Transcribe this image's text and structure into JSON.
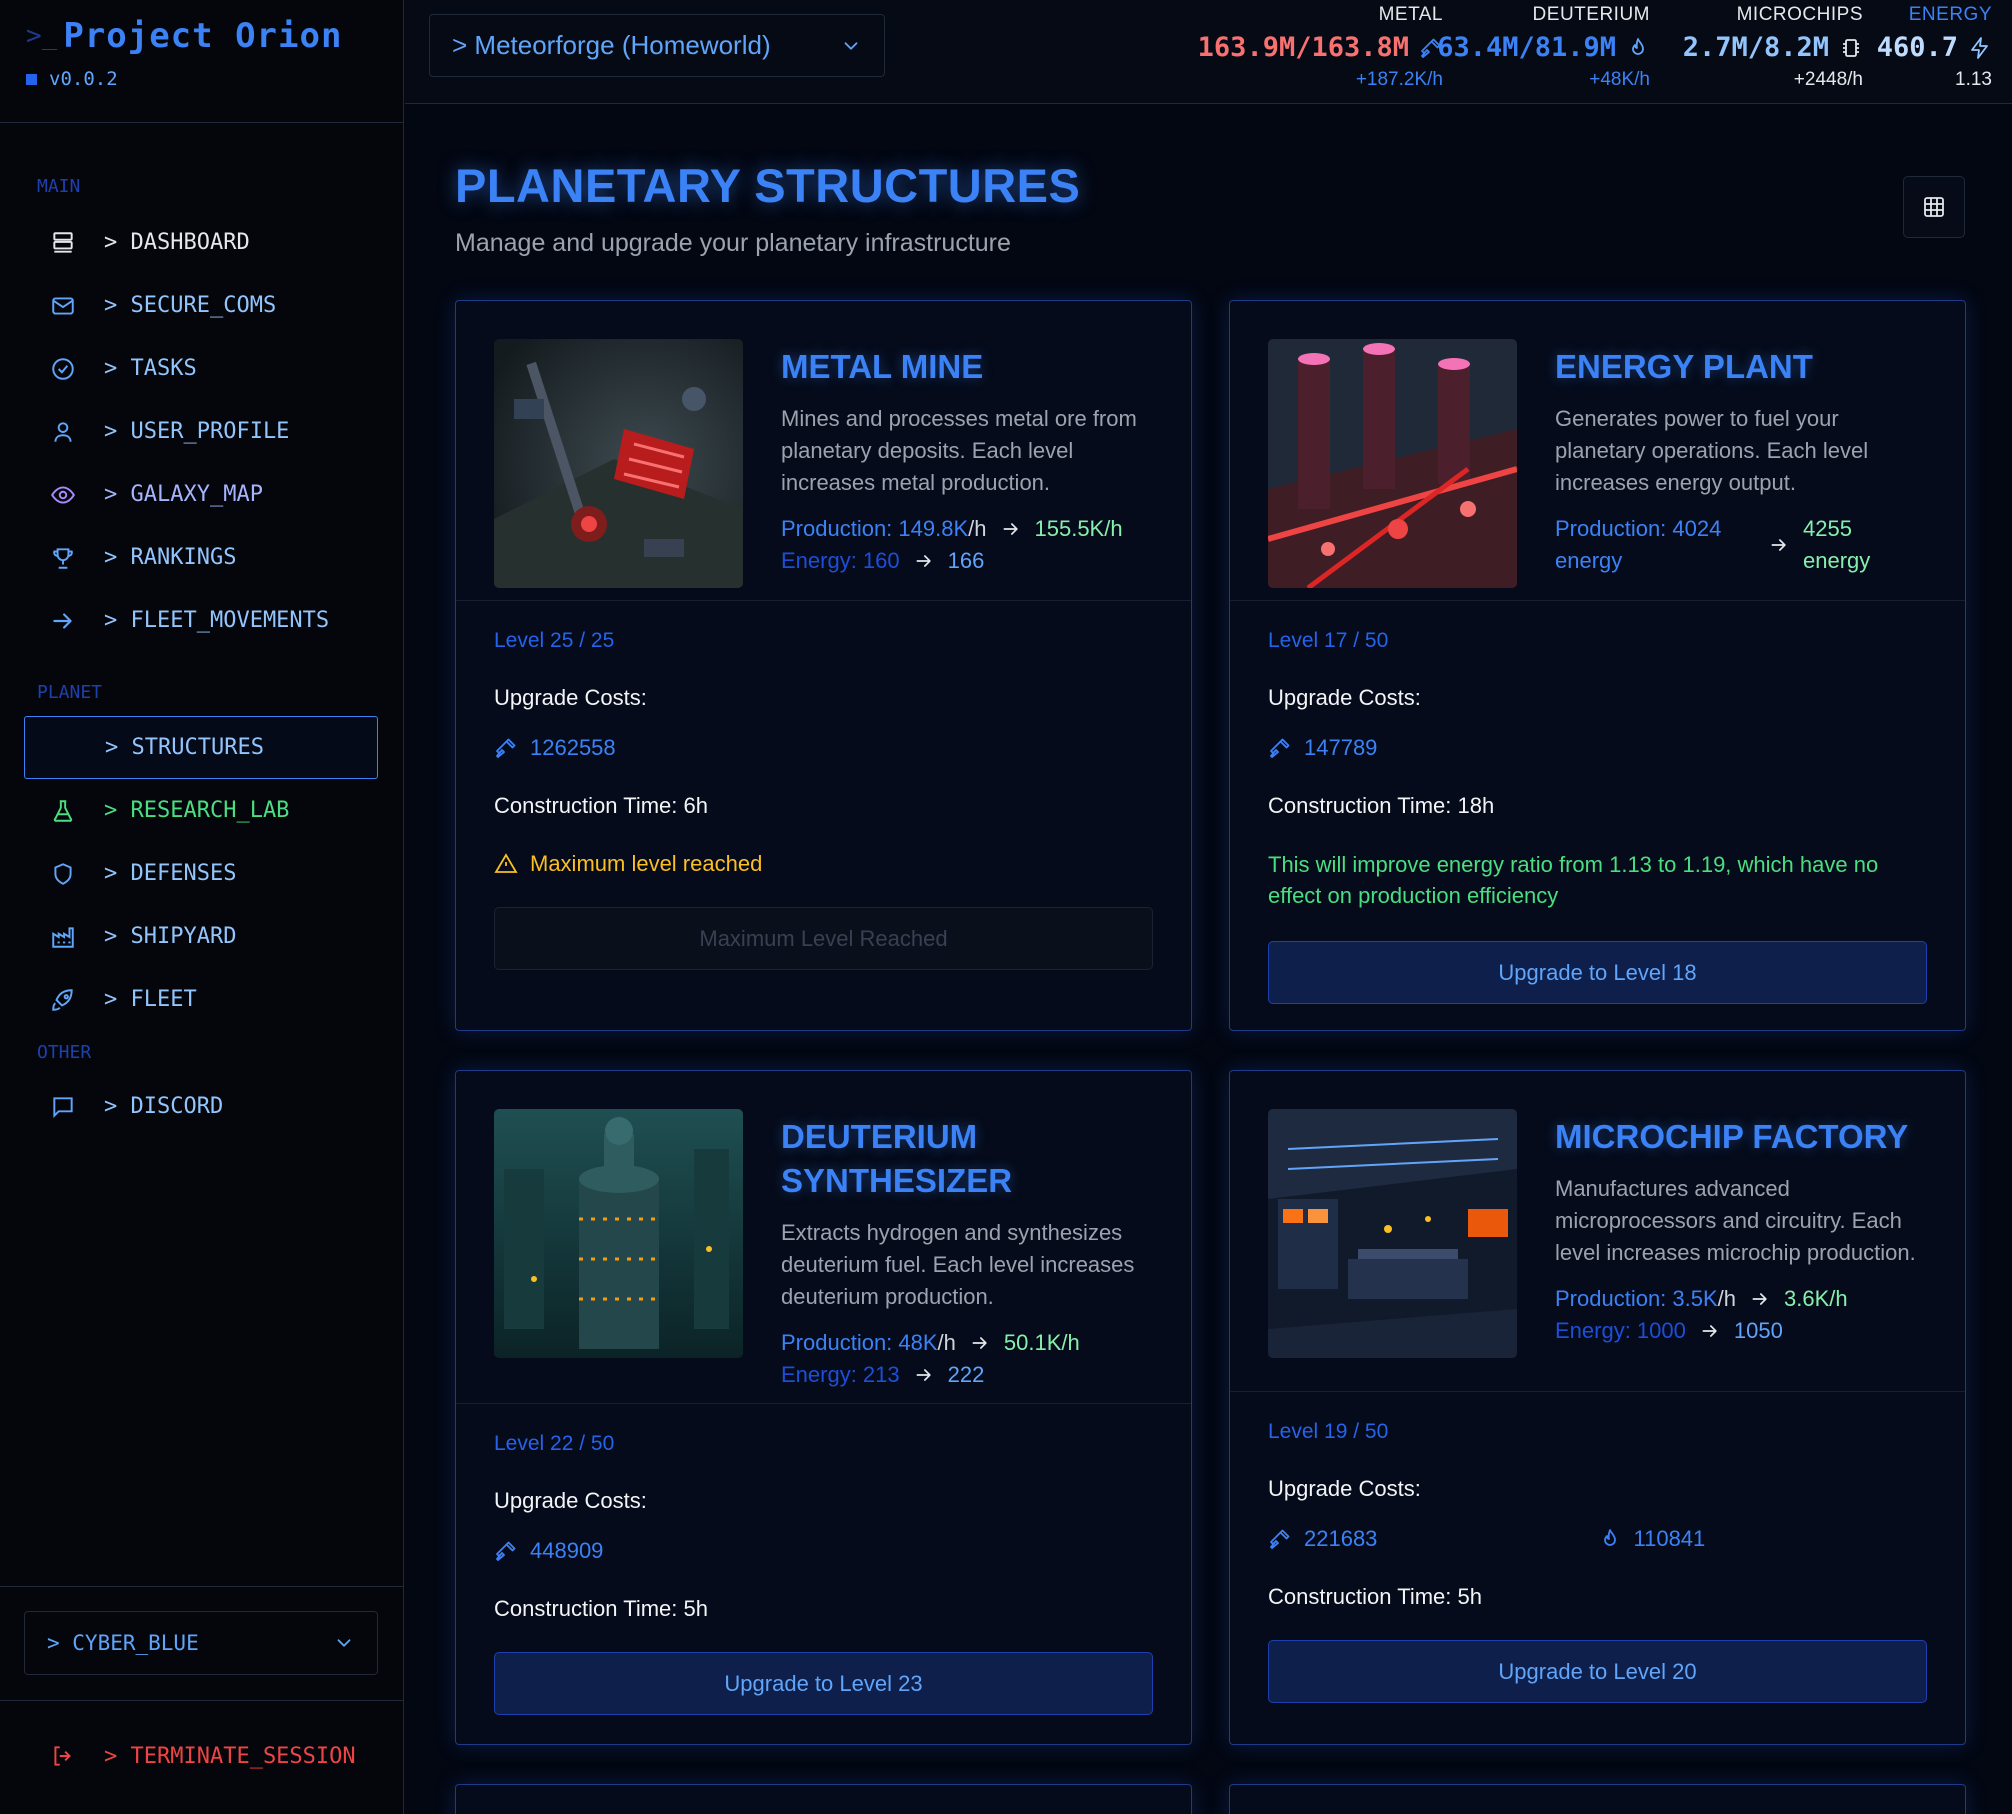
{
  "app": {
    "prompt": ">_",
    "name": "Project Orion",
    "version": "v0.0.2"
  },
  "sidebar": {
    "sections": {
      "main": "MAIN",
      "planet": "PLANET",
      "other": "OTHER"
    },
    "items": [
      {
        "label": "> DASHBOARD",
        "icon": "server-icon"
      },
      {
        "label": "> SECURE_COMS",
        "icon": "mail-icon"
      },
      {
        "label": "> TASKS",
        "icon": "check-circle-icon"
      },
      {
        "label": "> USER_PROFILE",
        "icon": "user-icon"
      },
      {
        "label": "> GALAXY_MAP",
        "icon": "eye-icon"
      },
      {
        "label": "> RANKINGS",
        "icon": "trophy-icon"
      },
      {
        "label": "> FLEET_MOVEMENTS",
        "icon": "arrow-right-icon"
      },
      {
        "label": "> STRUCTURES",
        "icon": "",
        "active": true
      },
      {
        "label": "> RESEARCH_LAB",
        "icon": "flask-icon"
      },
      {
        "label": "> DEFENSES",
        "icon": "shield-icon"
      },
      {
        "label": "> SHIPYARD",
        "icon": "factory-icon"
      },
      {
        "label": "> FLEET",
        "icon": "rocket-icon"
      },
      {
        "label": "> DISCORD",
        "icon": "message-icon"
      }
    ],
    "theme": "> CYBER_BLUE",
    "logout": "> TERMINATE_SESSION"
  },
  "topbar": {
    "planet": "> Meteorforge (Homeworld)",
    "resources": [
      {
        "label": "METAL",
        "value": "163.9M/163.8M",
        "rate": "+187.2K/h",
        "color": "#f87171",
        "rate_color": "#3b82f6",
        "icon": "pickaxe-icon"
      },
      {
        "label": "DEUTERIUM",
        "value": "63.4M/81.9M",
        "rate": "+48K/h",
        "color": "#3b82f6",
        "rate_color": "#3b82f6",
        "icon": "flame-icon"
      },
      {
        "label": "MICROCHIPS",
        "value": "2.7M/8.2M",
        "rate": "+2448/h",
        "color": "#93c5fd",
        "rate_color": "#e5e7eb",
        "icon": "chip-icon"
      },
      {
        "label": "ENERGY",
        "value": "460.7",
        "rate": "1.13",
        "color": "#bfdbfe",
        "rate_color": "#e5e7eb",
        "icon": "zap-icon"
      }
    ]
  },
  "page": {
    "title": "PLANETARY STRUCTURES",
    "subtitle": "Manage and upgrade your planetary infrastructure"
  },
  "structures": [
    {
      "name": "METAL MINE",
      "desc": "Mines and processes metal ore from planetary deposits. Each level increases metal production.",
      "prod_label": "Production: 149.8K",
      "prod_unit": "/h",
      "prod_new": "155.5K/h",
      "energy_label": "Energy: 160",
      "energy_new": "166",
      "level": "Level 25 / 25",
      "costs_label": "Upgrade Costs:",
      "cost_metal": "1262558",
      "time": "Construction Time: 6h",
      "warning": "Maximum level reached",
      "button": "Maximum Level Reached"
    },
    {
      "name": "ENERGY PLANT",
      "desc": "Generates power to fuel your planetary operations. Each level increases energy output.",
      "prod_label": "Production: 4024 energy",
      "prod_new": "4255 energy",
      "level": "Level 17 / 50",
      "costs_label": "Upgrade Costs:",
      "cost_metal": "147789",
      "time": "Construction Time: 18h",
      "note": "This will improve energy ratio from 1.13 to 1.19, which have no effect on production efficiency",
      "button": "Upgrade to Level 18"
    },
    {
      "name": "DEUTERIUM SYNTHESIZER",
      "desc": "Extracts hydrogen and synthesizes deuterium fuel. Each level increases deuterium production.",
      "prod_label": "Production: 48K",
      "prod_unit": "/h",
      "prod_new": "50.1K/h",
      "energy_label": "Energy: 213",
      "energy_new": "222",
      "level": "Level 22 / 50",
      "costs_label": "Upgrade Costs:",
      "cost_metal": "448909",
      "time": "Construction Time: 5h",
      "button": "Upgrade to Level 23"
    },
    {
      "name": "MICROCHIP FACTORY",
      "desc": "Manufactures advanced microprocessors and circuitry. Each level increases microchip production.",
      "prod_label": "Production: 3.5K",
      "prod_unit": "/h",
      "prod_new": "3.6K/h",
      "energy_label": "Energy: 1000",
      "energy_new": "1050",
      "level": "Level 19 / 50",
      "costs_label": "Upgrade Costs:",
      "cost_metal": "221683",
      "cost_deut": "110841",
      "time": "Construction Time: 5h",
      "button": "Upgrade to Level 20"
    }
  ]
}
